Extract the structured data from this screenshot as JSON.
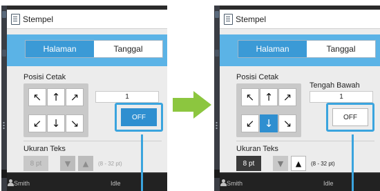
{
  "colors": {
    "accent": "#3aa4de",
    "tab_active": "#3b9ad6",
    "arrow_green": "#8cc63f"
  },
  "left": {
    "dialog_title": "Stempel",
    "tabs": [
      {
        "label": "Halaman"
      },
      {
        "label": "Tanggal"
      }
    ],
    "position_label": "Posisi Cetak",
    "arrows": [
      "↖",
      "↑",
      "↗",
      "↙",
      "↓",
      "↘"
    ],
    "count": "1",
    "off_label": "OFF",
    "text_size_label": "Ukuran Teks",
    "size_value": "8 pt",
    "minus_glyph": "▼",
    "plus_glyph": "▲",
    "range": "(8 - 32 pt)",
    "user": "Smith",
    "status": "Idle"
  },
  "right": {
    "dialog_title": "Stempel",
    "tabs": [
      {
        "label": "Halaman"
      },
      {
        "label": "Tanggal"
      }
    ],
    "position_label": "Posisi Cetak",
    "selected_position": "Tengah Bawah",
    "arrows": [
      "↖",
      "↑",
      "↗",
      "↙",
      "↓",
      "↘"
    ],
    "count": "1",
    "off_label": "OFF",
    "text_size_label": "Ukuran Teks",
    "size_value": "8 pt",
    "minus_glyph": "▼",
    "plus_glyph": "▲",
    "range": "(8 - 32 pt)",
    "user": "Smith",
    "status": "Idle"
  }
}
